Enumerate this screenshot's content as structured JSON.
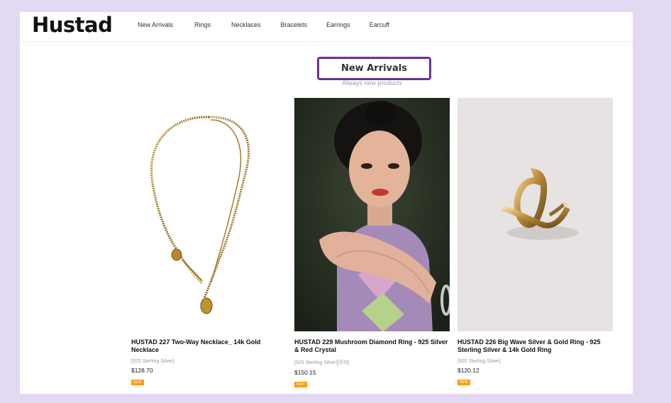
{
  "brand": {
    "logo": "Hustad"
  },
  "nav": {
    "items": [
      "New Arrivals",
      "Rings",
      "Necklaces",
      "Bracelets",
      "Earrings",
      "Earcuff"
    ]
  },
  "section": {
    "title": "New Arrivals",
    "subtitle": "Always new products"
  },
  "products": [
    {
      "name": "HUSTAD 227 Two-Way Necklace_ 14k Gold Necklace",
      "spec": "[925 Sterling Silver]",
      "price": "$128.70",
      "badge": "NEW",
      "image": "gold-necklace-photo"
    },
    {
      "name": "HUSTAD 229 Mushroom Diamond Ring - 925 Silver & Red Crystal",
      "spec": "[925 Sterling Silver][주비]",
      "price": "$150.15",
      "badge": "NEW",
      "image": "model-portrait-photo"
    },
    {
      "name": "HUSTAD 226 Big Wave Silver & Gold Ring - 925 Sterling Silver & 14k Gold Ring",
      "spec": "[925 Sterling Silver]",
      "price": "$120.12",
      "badge": "NEW",
      "image": "gold-ring-photo"
    }
  ],
  "colors": {
    "background": "#e4d9f3",
    "highlight_border": "#6b2fa0",
    "badge": "#ff9a00"
  }
}
